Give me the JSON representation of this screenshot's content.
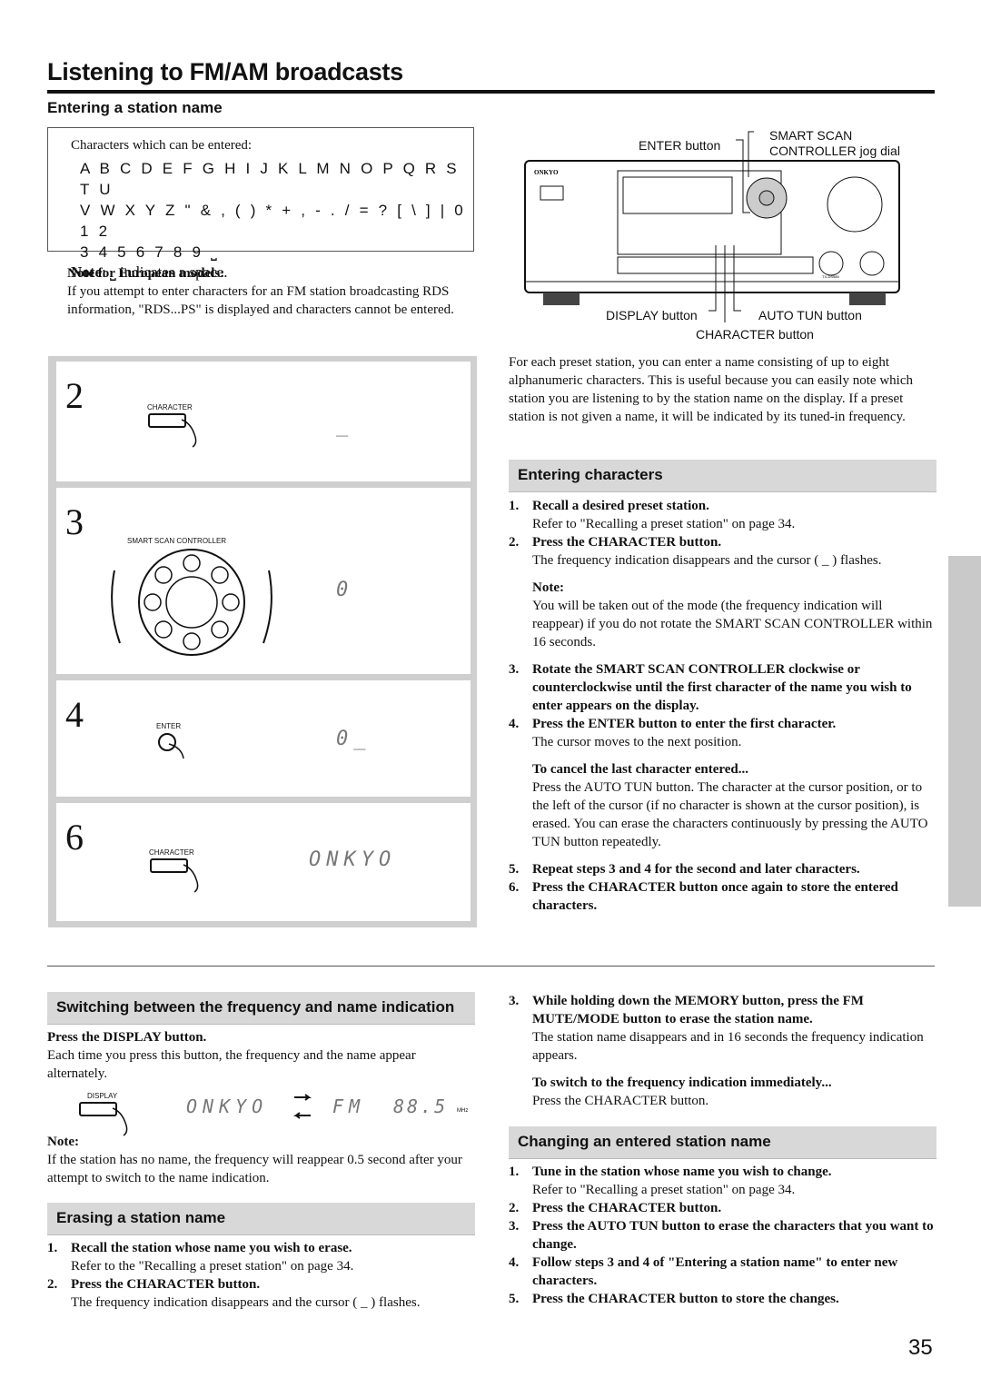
{
  "page_title": "Listening to FM/AM broadcasts",
  "section_title": "Entering a station name",
  "char_box": {
    "intro": "Characters which can be entered:",
    "rows": [
      "A B C D E F G H I J K L M N O P Q R S T U",
      "V W X Y Z \" & , ( ) * + , - . / = ? [ \\ ] | 0 1 2",
      "3 4 5 6 7 8 9 ⎵"
    ],
    "note_label": "Note",
    "note_text": ": ⎵ indicates a space."
  },
  "european": {
    "title": "Note for European models:",
    "text": "If you attempt to enter characters for an FM station broadcasting RDS information, \"RDS...PS\" is displayed and characters cannot be entered."
  },
  "steps": [
    {
      "num": "2",
      "button": "CHARACTER",
      "display": "_"
    },
    {
      "num": "3",
      "button": "SMART SCAN CONTROLLER",
      "display": "0"
    },
    {
      "num": "4",
      "button": "ENTER",
      "display": "0_"
    },
    {
      "num": "6",
      "button": "CHARACTER",
      "display": "ONKYO"
    }
  ],
  "diagram": {
    "brand": "ONKYO",
    "model": "TX-DS585",
    "enter": "ENTER button",
    "smart1": "SMART SCAN",
    "smart2": "CONTROLLER jog dial",
    "display": "DISPLAY button",
    "auto": "AUTO TUN button",
    "character": "CHARACTER button"
  },
  "intro": "For each preset station, you can enter a name consisting of up to eight alphanumeric characters. This is useful because you can easily note which station you are listening to by the station name on the display. If a preset station is not given a name, it will be indicated by its tuned-in frequency.",
  "entering": {
    "title": "Entering characters",
    "items": [
      {
        "n": "1.",
        "head": "Recall a desired preset station.",
        "body": "Refer to \"Recalling a preset station\" on page 34."
      },
      {
        "n": "2.",
        "head": "Press the CHARACTER button.",
        "body": "The frequency indication disappears and the cursor ( _ ) flashes."
      }
    ],
    "note_title": "Note:",
    "note": "You will be taken out of the mode (the frequency indication will reappear) if you do not rotate the SMART SCAN CONTROLLER within 16 seconds.",
    "items2": [
      {
        "n": "3.",
        "head": "Rotate the SMART SCAN CONTROLLER clockwise or counterclockwise until the first character of the name you wish to enter appears on the display.",
        "body": ""
      },
      {
        "n": "4.",
        "head": "Press the ENTER button to enter the first character.",
        "body": "The cursor moves to the next position."
      }
    ],
    "cancel_title": "To cancel the last character entered...",
    "cancel": "Press the AUTO TUN button. The character at the cursor position, or to the left of the cursor (if no character is shown at the cursor position), is erased. You can erase the characters continuously by pressing the AUTO TUN button repeatedly.",
    "items3": [
      {
        "n": "5.",
        "head": "Repeat steps 3 and 4 for the second and later characters."
      },
      {
        "n": "6.",
        "head": "Press the CHARACTER button once again to store the entered characters."
      }
    ]
  },
  "switching": {
    "title": "Switching between the frequency and name indication",
    "head": "Press the DISPLAY button.",
    "body": "Each time you press this button, the frequency and the name appear alternately.",
    "button": "DISPLAY",
    "name": "ONKYO",
    "band": "FM",
    "freq": "88.5",
    "unit": "MHz",
    "note_title": "Note:",
    "note": "If the station has no name, the frequency will reappear 0.5 second after your attempt to switch to the name indication."
  },
  "erasing": {
    "title": "Erasing a station name",
    "items": [
      {
        "n": "1.",
        "head": "Recall the station whose name you wish to erase.",
        "body": "Refer to the \"Recalling a preset station\" on page 34."
      },
      {
        "n": "2.",
        "head": "Press the CHARACTER button.",
        "body": "The frequency indication disappears and the cursor ( _ ) flashes."
      },
      {
        "n": "3.",
        "head": "While holding down the MEMORY button, press the FM MUTE/MODE button to erase the station name.",
        "body": "The station name disappears and in 16 seconds the frequency indication appears."
      }
    ],
    "switch_title": "To switch to the frequency indication immediately...",
    "switch_body": "Press the CHARACTER button."
  },
  "changing": {
    "title": "Changing an entered station name",
    "items": [
      {
        "n": "1.",
        "head": "Tune in the station whose name you wish to change.",
        "body": "Refer to \"Recalling a preset station\" on page 34."
      },
      {
        "n": "2.",
        "head": "Press the CHARACTER button.",
        "body": ""
      },
      {
        "n": "3.",
        "head": "Press the AUTO TUN button to erase the characters that you want to change.",
        "body": ""
      },
      {
        "n": "4.",
        "head": "Follow steps 3 and 4 of \"Entering a station name\" to enter new characters.",
        "body": ""
      },
      {
        "n": "5.",
        "head": "Press the CHARACTER button to store the changes.",
        "body": ""
      }
    ]
  },
  "page_number": "35"
}
